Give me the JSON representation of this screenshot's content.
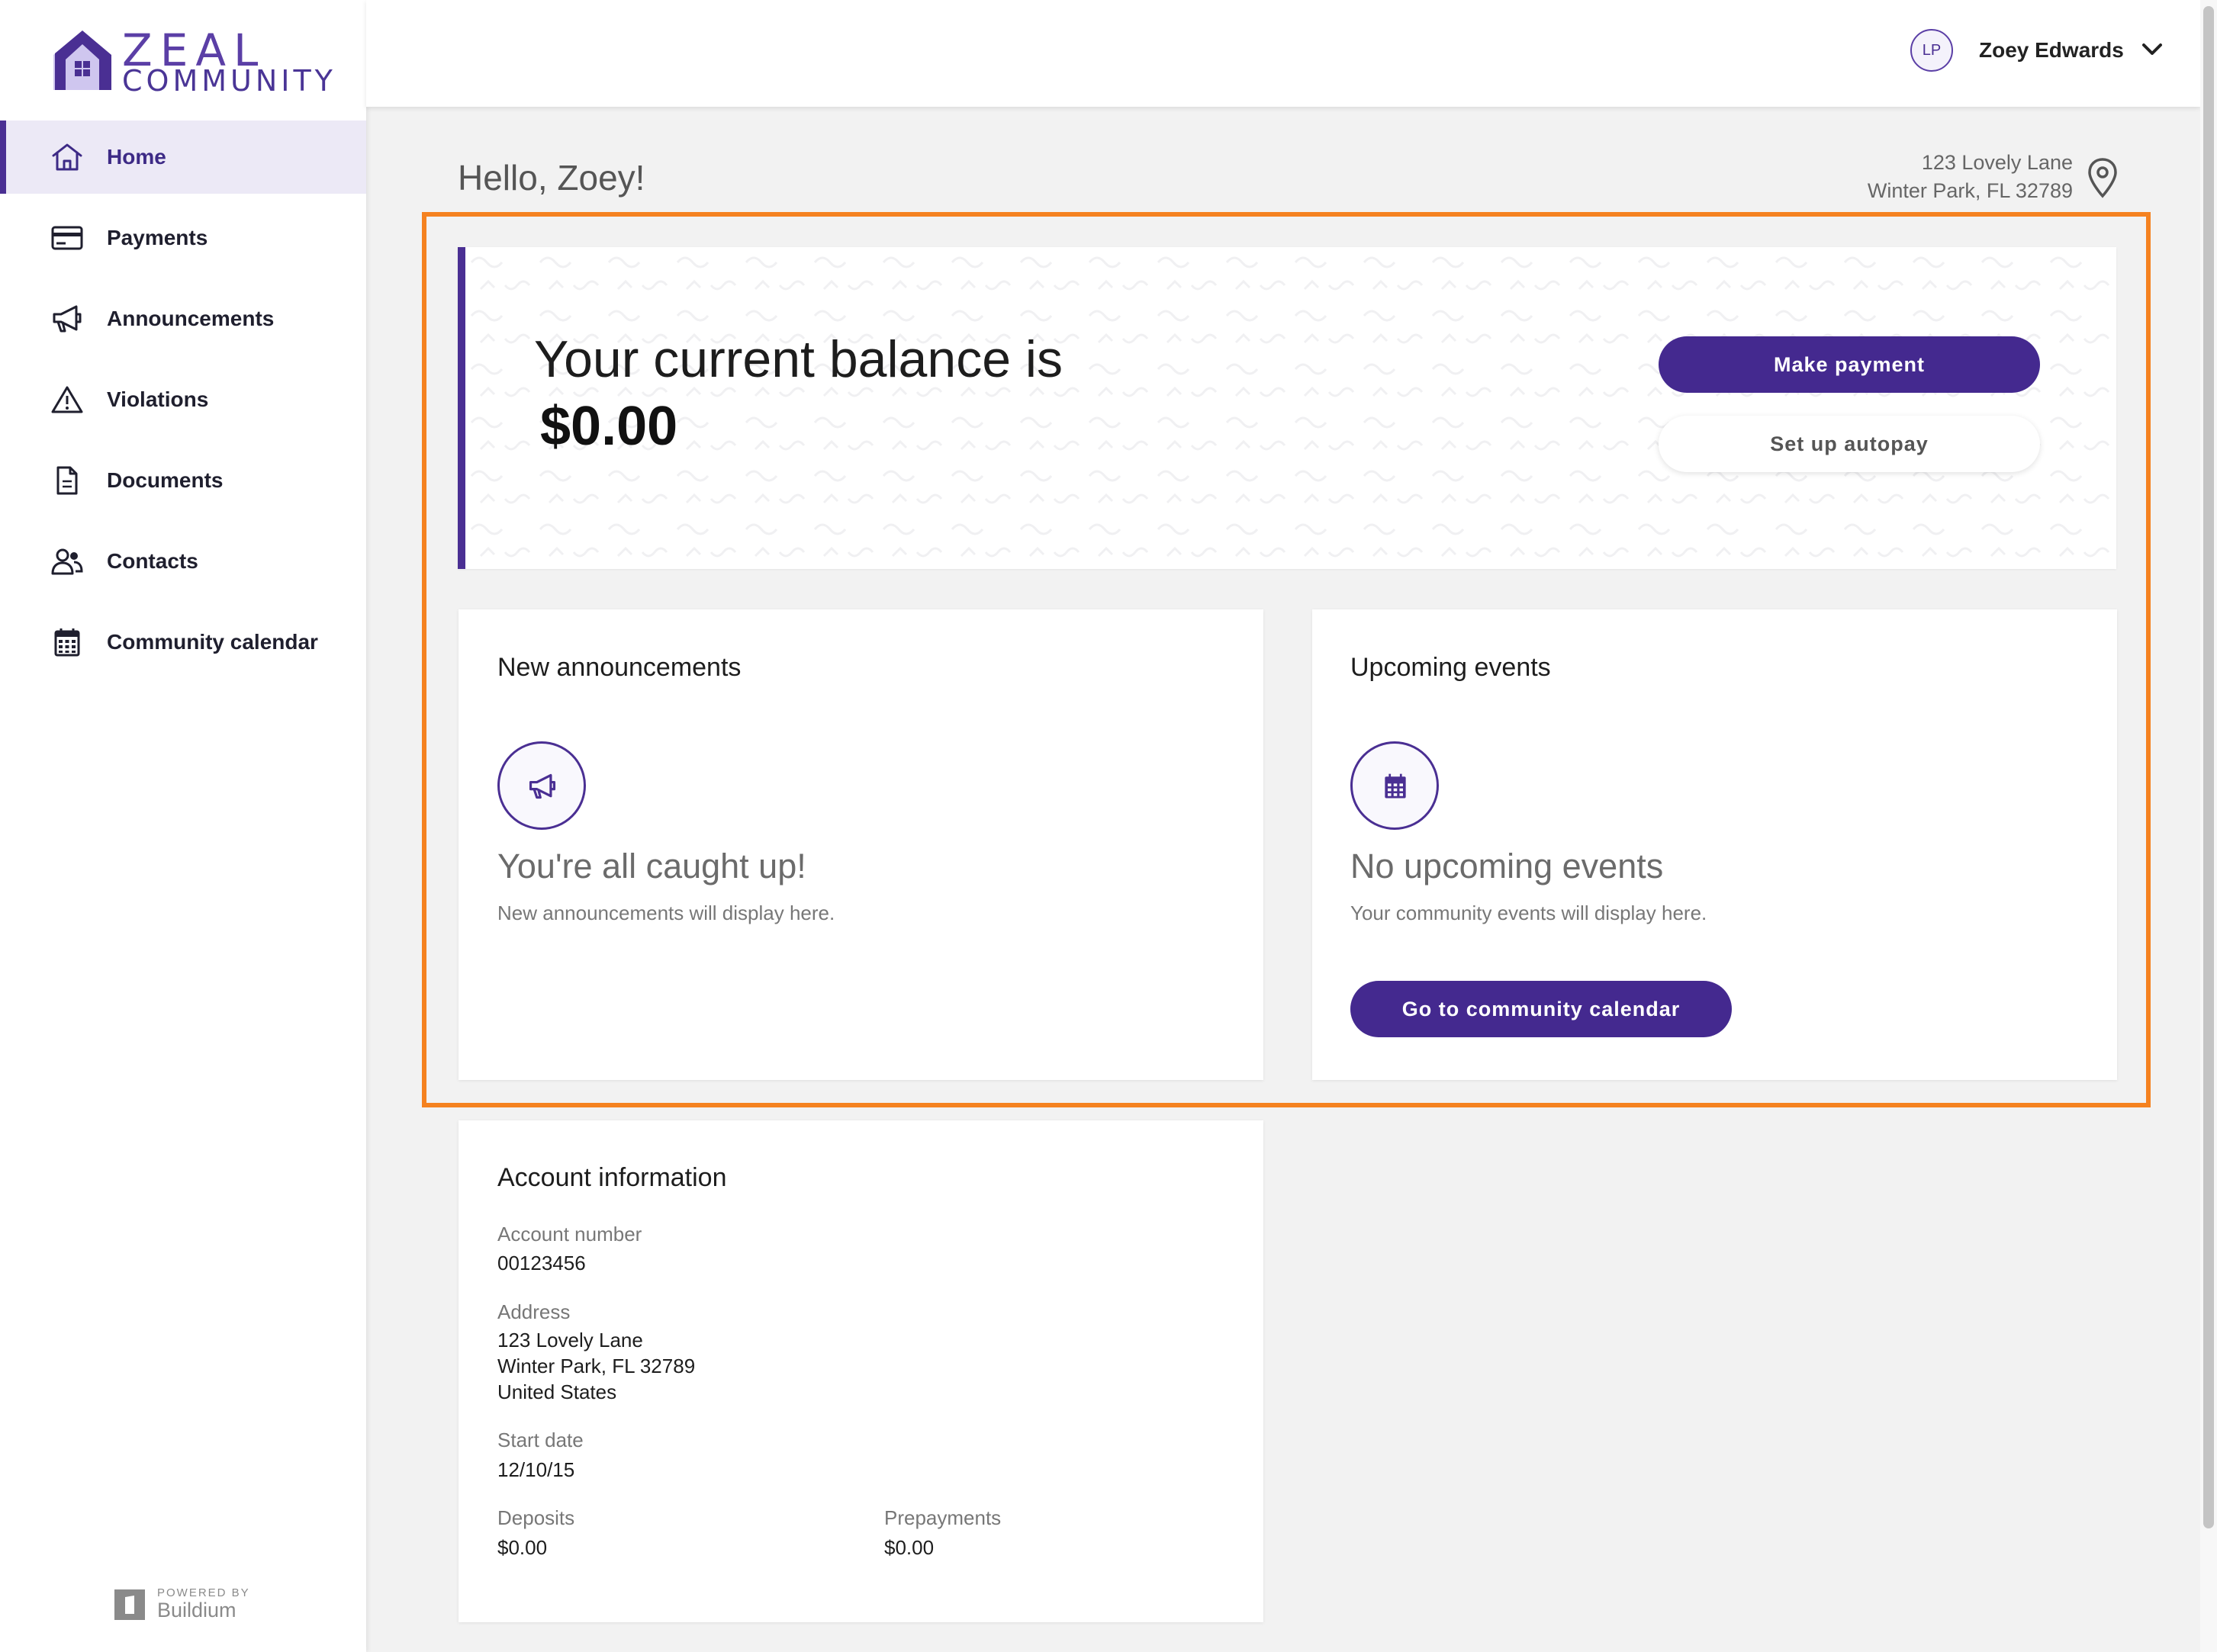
{
  "brand": {
    "line1": "ZEAL",
    "line2": "COMMUNITY"
  },
  "sidebar": {
    "items": [
      {
        "label": "Home",
        "icon": "home-icon",
        "active": true
      },
      {
        "label": "Payments",
        "icon": "credit-card-icon"
      },
      {
        "label": "Announcements",
        "icon": "megaphone-icon"
      },
      {
        "label": "Violations",
        "icon": "warning-icon"
      },
      {
        "label": "Documents",
        "icon": "document-icon"
      },
      {
        "label": "Contacts",
        "icon": "contacts-icon"
      },
      {
        "label": "Community calendar",
        "icon": "calendar-icon"
      }
    ],
    "powered_by": "POWERED BY",
    "powered_name": "Buildium"
  },
  "header": {
    "avatar_initials": "LP",
    "user_name": "Zoey Edwards"
  },
  "greeting": "Hello, Zoey!",
  "property_address": {
    "line1": "123 Lovely Lane",
    "line2": "Winter Park, FL 32789"
  },
  "balance": {
    "label": "Your current balance is",
    "amount": "$0.00",
    "make_payment": "Make payment",
    "autopay": "Set up autopay"
  },
  "announcements": {
    "title": "New announcements",
    "empty_heading": "You're all caught up!",
    "empty_sub": "New announcements will display here."
  },
  "events": {
    "title": "Upcoming events",
    "empty_heading": "No upcoming events",
    "empty_sub": "Your community events will display here.",
    "calendar_button": "Go to community calendar"
  },
  "account": {
    "title": "Account information",
    "account_number_label": "Account number",
    "account_number": "00123456",
    "address_label": "Address",
    "address_line1": "123 Lovely Lane",
    "address_line2": "Winter Park, FL 32789",
    "address_line3": "United States",
    "start_date_label": "Start date",
    "start_date": "12/10/15",
    "deposits_label": "Deposits",
    "deposits": "$0.00",
    "prepayments_label": "Prepayments",
    "prepayments": "$0.00"
  },
  "colors": {
    "accent": "#44298f",
    "highlight": "#f58220",
    "active_nav_bg": "#ece9f6"
  }
}
